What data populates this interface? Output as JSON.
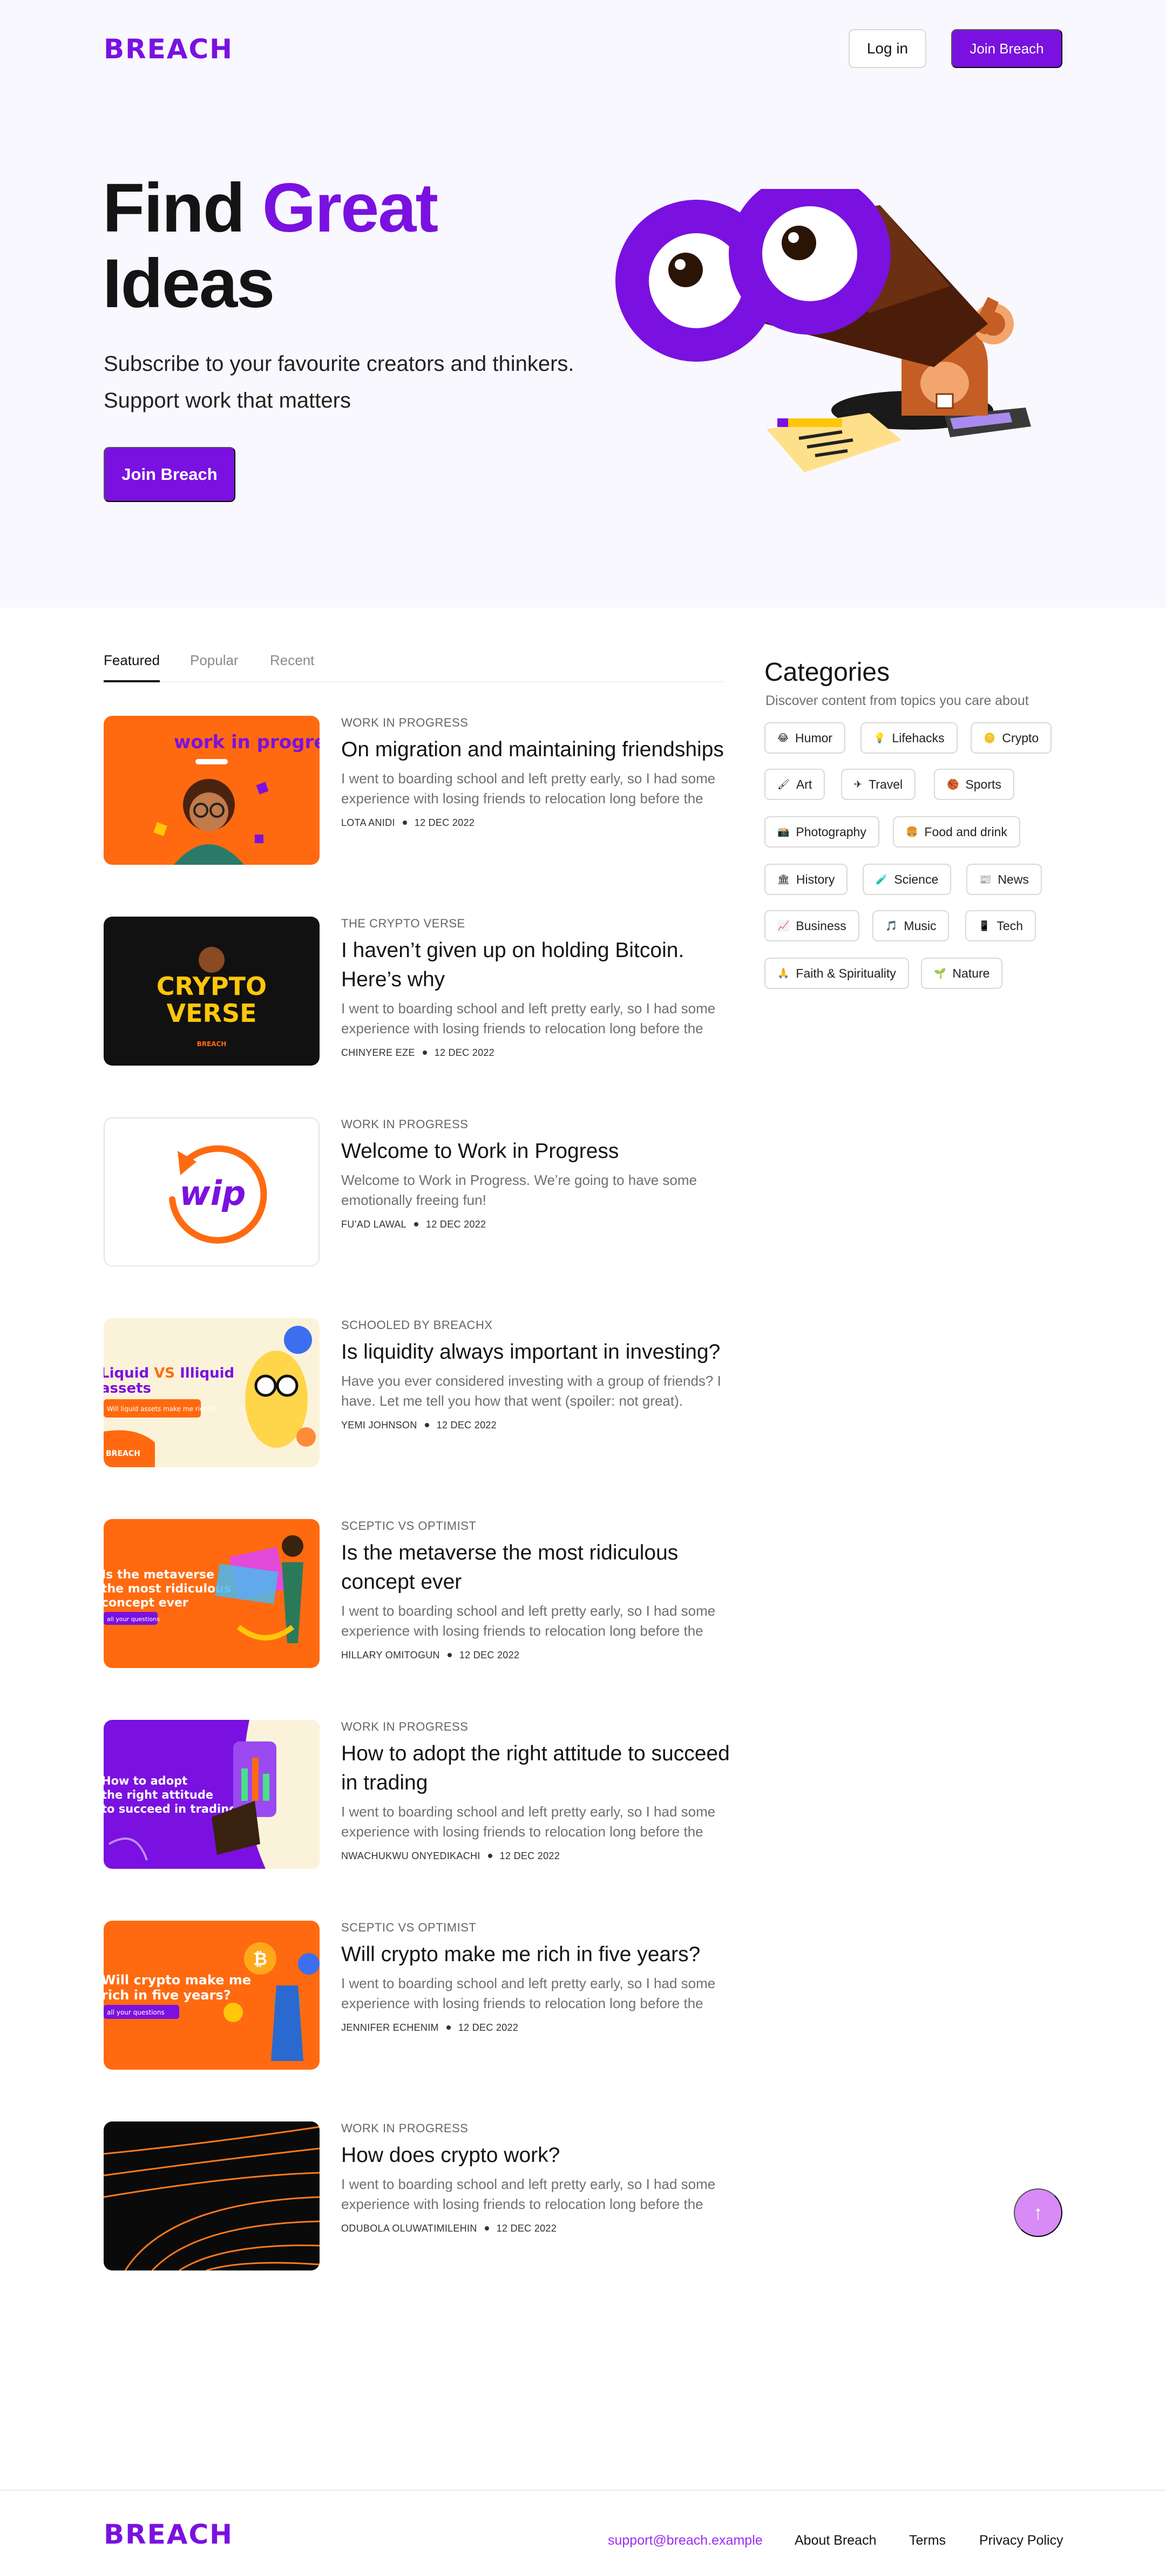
{
  "brand": {
    "logo": "BREACH"
  },
  "nav": {
    "login": "Log in",
    "join": "Join Breach"
  },
  "hero": {
    "title_part1": "Find ",
    "title_accent": "Great",
    "title_part2": "Ideas",
    "subtitle_line1": "Subscribe to your favourite creators and thinkers.",
    "subtitle_line2": "Support work that matters",
    "cta": "Join Breach"
  },
  "tabs": [
    "Featured",
    "Popular",
    "Recent"
  ],
  "articles": [
    {
      "tag": "WORK IN PROGRESS",
      "title": "On migration and maintaining friendships",
      "excerpt": "I went to boarding school and left pretty early, so I had some experience with losing friends to relocation long before the",
      "author": "LOTA ANIDI",
      "date": "12 DEC 2022",
      "thumb_text": "work in progress"
    },
    {
      "tag": "THE CRYPTO VERSE",
      "title": "I haven’t given up on holding Bitcoin. Here’s why",
      "excerpt": "I went to boarding school and left pretty early, so I had some experience with losing friends to relocation long before the",
      "author": "CHINYERE EZE",
      "date": "12 DEC 2022",
      "thumb_text1": "CRYPTO",
      "thumb_text2": "VERSE",
      "thumb_text3": "BREACH"
    },
    {
      "tag": "WORK IN PROGRESS",
      "title": "Welcome to Work in Progress",
      "excerpt": "Welcome to Work in Progress. We’re going to have some emotionally freeing fun!",
      "author": "FU’AD LAWAL",
      "date": "12 DEC 2022",
      "thumb_text": "wip"
    },
    {
      "tag": "SCHOOLED BY BREACHX",
      "title": "Is liquidity always important in investing?",
      "excerpt": "Have you ever considered investing with a group of friends? I have. Let me tell you how that went (spoiler: not great).",
      "author": "YEMI JOHNSON",
      "date": "12 DEC 2022",
      "thumb_text1": "Liquid",
      "thumb_text2": "VS",
      "thumb_text3": "Illiquid",
      "thumb_text4": "assets",
      "thumb_text5": "Will liquid assets make me richer?",
      "thumb_text6": "BREACH"
    },
    {
      "tag": "SCEPTIC VS OPTIMIST",
      "title": "Is the metaverse the most ridiculous concept ever",
      "excerpt": "I went to boarding school and left pretty early, so I had some experience with losing friends to relocation long before the",
      "author": "HILLARY OMITOGUN",
      "date": "12 DEC 2022",
      "thumb_text1": "Is the metaverse",
      "thumb_text2": "the most ridiculous",
      "thumb_text3": "concept ever",
      "thumb_text4": "all your questions"
    },
    {
      "tag": "WORK IN PROGRESS",
      "title": "How to adopt the right attitude to succeed in trading",
      "excerpt": "I went to boarding school and left pretty early, so I had some experience with losing friends to relocation long before the",
      "author": "NWACHUKWU ONYEDIKACHI",
      "date": "12 DEC 2022",
      "thumb_text1": "How to adopt",
      "thumb_text2": "the right attitude",
      "thumb_text3": "to succeed in trading."
    },
    {
      "tag": "SCEPTIC VS OPTIMIST",
      "title": "Will crypto make me rich in five years?",
      "excerpt": "I went to boarding school and left pretty early, so I had some experience with losing friends to relocation long before the",
      "author": "JENNIFER ECHENIM",
      "date": "12 DEC 2022",
      "thumb_text1": "Will crypto make me",
      "thumb_text2": "rich in five years?",
      "thumb_text3": "all your questions"
    },
    {
      "tag": "WORK IN PROGRESS",
      "title": "How does crypto work?",
      "excerpt": "I went to boarding school and left pretty early, so I had some experience with losing friends to relocation long before the",
      "author": "ODUBOLA OLUWATIMILEHIN",
      "date": "12 DEC 2022"
    }
  ],
  "categories": {
    "title": "Categories",
    "subtitle": "Discover content from topics you care about",
    "items": [
      {
        "label": "Humor",
        "icon": "😂"
      },
      {
        "label": "Lifehacks",
        "icon": "💡"
      },
      {
        "label": "Crypto",
        "icon": "🪙"
      },
      {
        "label": "Art",
        "icon": "🖌"
      },
      {
        "label": "Travel",
        "icon": "✈"
      },
      {
        "label": "Sports",
        "icon": "🏀"
      },
      {
        "label": "Photography",
        "icon": "📸"
      },
      {
        "label": "Food and drink",
        "icon": "🍔"
      },
      {
        "label": "History",
        "icon": "🏛"
      },
      {
        "label": "Science",
        "icon": "🧪"
      },
      {
        "label": "News",
        "icon": "📰"
      },
      {
        "label": "Business",
        "icon": "📈"
      },
      {
        "label": "Music",
        "icon": "🎵"
      },
      {
        "label": "Tech",
        "icon": "📱"
      },
      {
        "label": "Faith & Spirituality",
        "icon": "🙏"
      },
      {
        "label": "Nature",
        "icon": "🌱"
      }
    ]
  },
  "scroll_top": "↑",
  "footer": {
    "logo": "BREACH",
    "email": "support@breach.example",
    "about": "About Breach",
    "terms": "Terms",
    "privacy": "Privacy Policy"
  },
  "colors": {
    "brand_purple": "#7a11e0",
    "hero_bg": "#f9f8fe",
    "orange": "#ff6a10",
    "scroll_button": "#d88af7"
  }
}
